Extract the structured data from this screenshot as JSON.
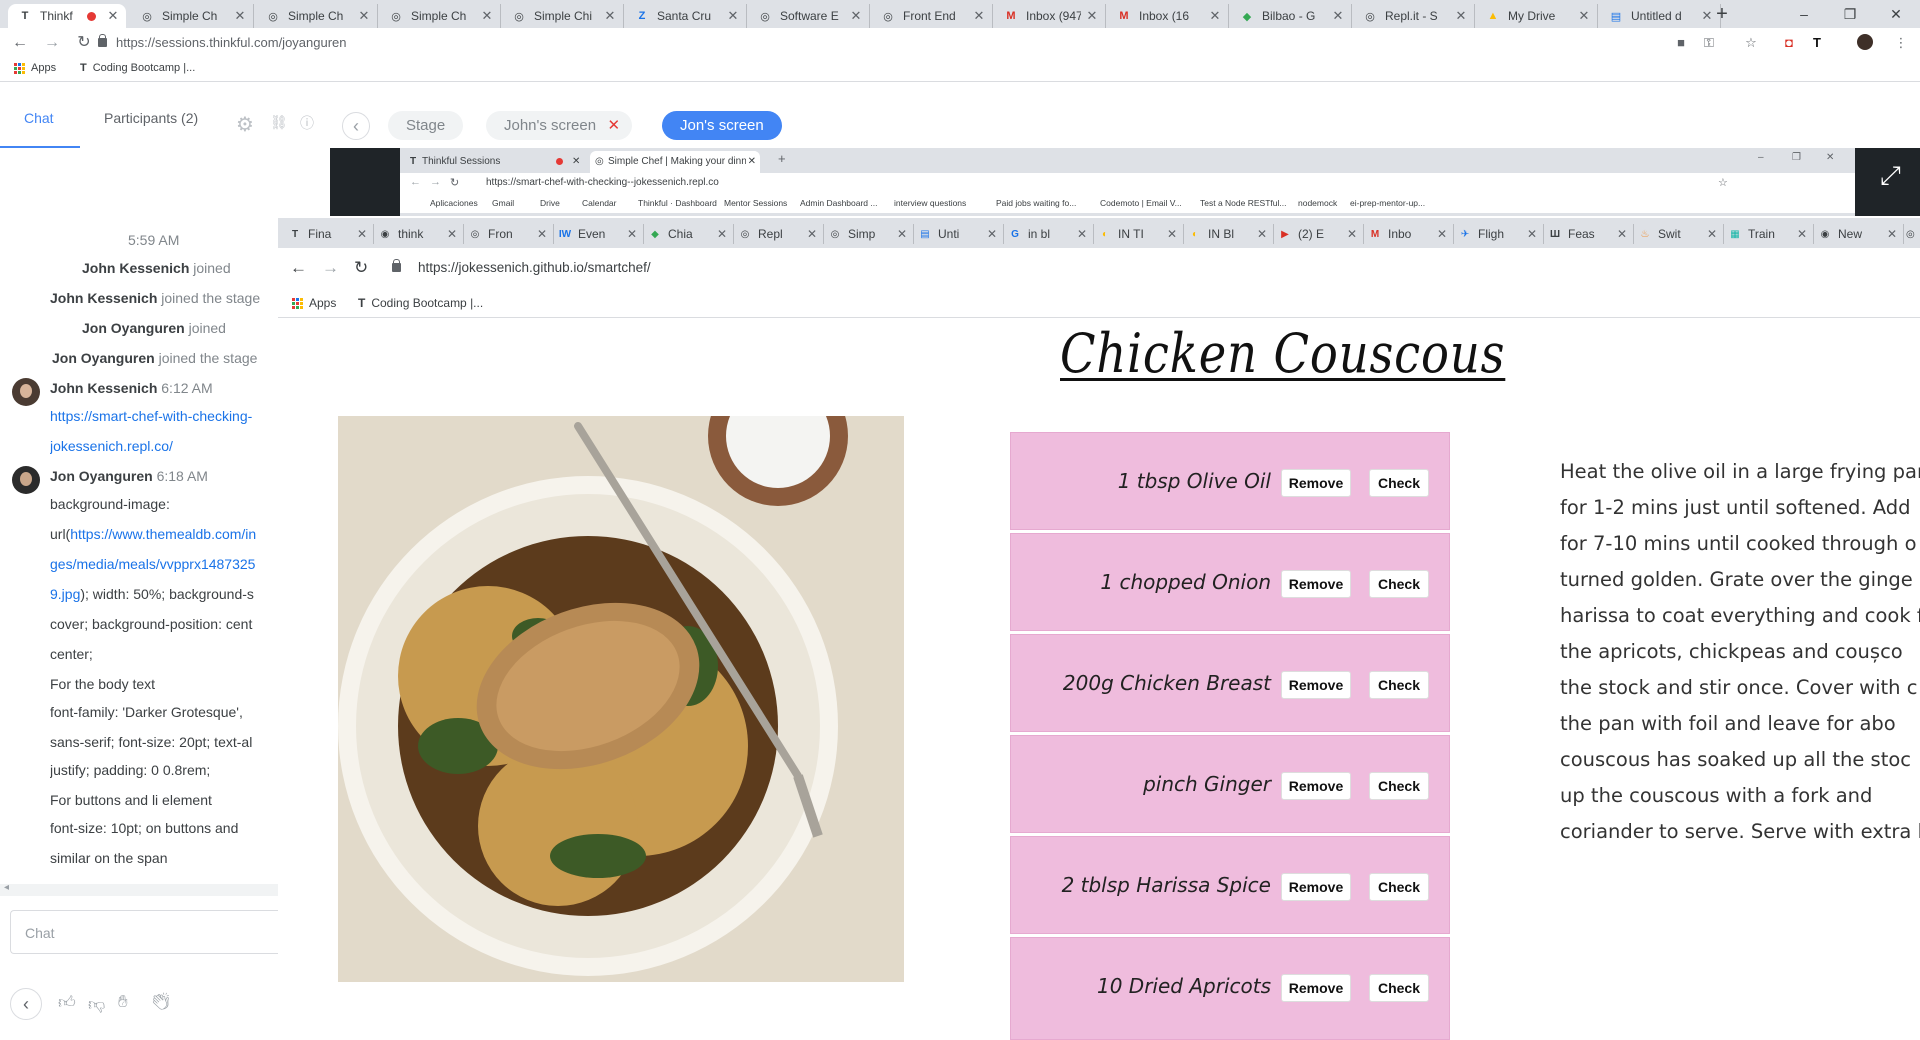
{
  "outer_tabs": [
    {
      "label": "Thinkf",
      "icon": "thinkful-icon",
      "active": true,
      "recording": true
    },
    {
      "label": "Simple Ch",
      "icon": "globe-icon"
    },
    {
      "label": "Simple Ch",
      "icon": "globe-icon"
    },
    {
      "label": "Simple Ch",
      "icon": "globe-icon"
    },
    {
      "label": "Simple Chi",
      "icon": "globe-icon"
    },
    {
      "label": "Santa Cru",
      "icon": "zillow-icon"
    },
    {
      "label": "Software E",
      "icon": "globe-icon"
    },
    {
      "label": "Front End",
      "icon": "globe-icon"
    },
    {
      "label": "Inbox (947",
      "icon": "gmail-icon"
    },
    {
      "label": "Inbox (16",
      "icon": "gmail-icon"
    },
    {
      "label": "Bilbao - G",
      "icon": "maps-icon"
    },
    {
      "label": "Repl.it - S",
      "icon": "replit-icon"
    },
    {
      "label": "My Drive",
      "icon": "drive-icon"
    },
    {
      "label": "Untitled d",
      "icon": "docs-icon"
    }
  ],
  "new_tab": "+",
  "window_controls": {
    "minimize": "–",
    "restore": "❐",
    "close": "✕"
  },
  "url": "https://sessions.thinkful.com/joyanguren",
  "bookmarks": {
    "apps": "Apps",
    "item1": "Coding Bootcamp |..."
  },
  "session": {
    "tab_chat": "Chat",
    "tab_participants": "Participants (2)",
    "pills": [
      {
        "label": "Stage"
      },
      {
        "label": "John's screen",
        "closable": true
      },
      {
        "label": "Jon's screen",
        "active": true
      }
    ],
    "back": "‹",
    "expand": "⤢"
  },
  "chat": {
    "time": "5:59 AM",
    "events": [
      {
        "name": "John Kessenich",
        "text": " joined"
      },
      {
        "name": "John Kessenich",
        "text": " joined the stage"
      },
      {
        "name": "Jon Oyanguren",
        "text": " joined"
      },
      {
        "name": "Jon Oyanguren",
        "text": " joined the stage"
      }
    ],
    "msg1": {
      "author": "John Kessenich",
      "time": "6:12 AM",
      "lines": [
        "https://smart-chef-with-checking-",
        "jokessenich.repl.co/"
      ]
    },
    "msg2": {
      "author": "Jon Oyanguren",
      "time": "6:18 AM",
      "line1": "background-image:",
      "line2_pre": "url(",
      "line2_link": "https://www.themealdb.com/in",
      "line3_link": "ges/media/meals/vvpprx1487325",
      "line4_link": "9.jpg",
      "line4_post": "); width: 50%; background-s",
      "line5": "cover; background-position: cent",
      "line6": "center;",
      "line7": "For the body text",
      "line8": "font-family: 'Darker Grotesque',",
      "line9": "sans-serif; font-size: 20pt; text-al",
      "line10": "justify; padding: 0 0.8rem;",
      "line11": "For buttons and li element",
      "line12": "font-size: 10pt; on buttons and",
      "line13": "similar on the span"
    },
    "input_placeholder": "Chat"
  },
  "inner_window": {
    "tabs": [
      {
        "label": "Thinkful Sessions",
        "recording": true
      },
      {
        "label": "Simple Chef | Making your dinne",
        "active": true
      }
    ],
    "url": "https://smart-chef-with-checking--jokessenich.repl.co",
    "bookmarks": [
      "Aplicaciones",
      "Gmail",
      "Drive",
      "Calendar",
      "Thinkful · Dashboard",
      "Mentor Sessions",
      "Admin Dashboard ...",
      "interview questions",
      "Paid jobs waiting fo...",
      "Codemoto | Email V...",
      "Test a Node RESTful...",
      "nodemock",
      "ei-prep-mentor-up..."
    ]
  },
  "third_window": {
    "tabs": [
      "Fina",
      "think",
      "Fron",
      "Even",
      "Chia",
      "Repl",
      "Simp",
      "Unti",
      "in bl",
      "IN TI",
      "IN Bl",
      "(2) E",
      "Inbo",
      "Fligh",
      "Feas",
      "Swit",
      "Train",
      "New"
    ],
    "url": "https://jokessenich.github.io/smartchef/",
    "bookmarks": {
      "apps": "Apps",
      "item1": "Coding Bootcamp |..."
    }
  },
  "recipe": {
    "title": "Chicken Couscous",
    "remove_label": "Remove",
    "check_label": "Check",
    "ingredients": [
      "1 tbsp Olive Oil",
      "1 chopped Onion",
      "200g Chicken Breast",
      "pinch Ginger",
      "2 tblsp Harissa Spice",
      "10 Dried Apricots"
    ],
    "method_lines": [
      "Heat the olive oil in a large frying pan",
      "for 1-2 mins just until softened. Add",
      "for 7-10 mins until cooked through o",
      "turned golden. Grate over the ginge",
      "harissa to coat everything and cook f",
      "the apricots, chickpeas and coușco",
      "the stock and stir once. Cover with c",
      "the pan with foil and leave for abo",
      "couscous has soaked up all the stoc",
      "up the couscous with a fork and",
      "coriander to serve. Serve with extra h"
    ]
  },
  "colors": {
    "accent": "#4285f4",
    "ingredient_bg": "#efbcdd",
    "record": "#e53935"
  }
}
